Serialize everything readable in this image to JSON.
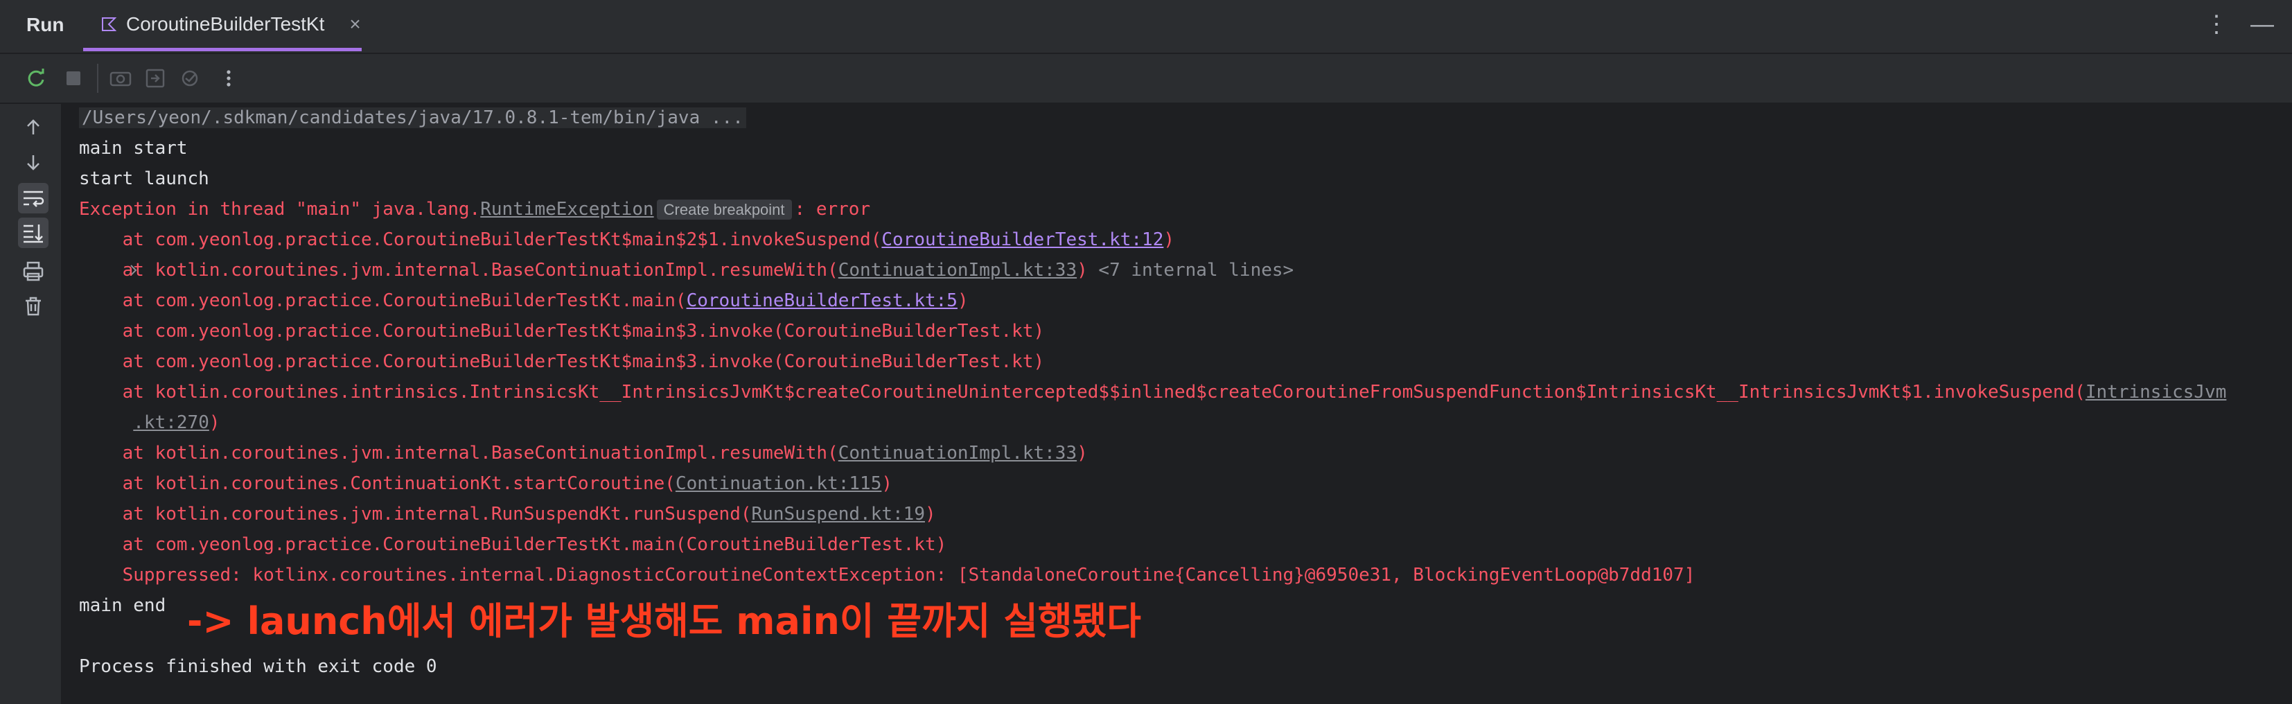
{
  "header": {
    "run_label": "Run",
    "active_tab": "CoroutineBuilderTestKt",
    "tab_close": "×",
    "more_icon": "⋮",
    "minimize_icon": "—"
  },
  "toolbar": {
    "icons": [
      "rerun-icon",
      "stop-icon",
      "camera-icon",
      "restore-layout-icon",
      "settings-icon",
      "more-icon"
    ]
  },
  "left_toolbar": {
    "icons": [
      "scroll-up-icon",
      "scroll-down-icon",
      "soft-wrap-icon",
      "scroll-to-end-icon",
      "print-icon",
      "clear-icon"
    ]
  },
  "console": {
    "command": "/Users/yeon/.sdkman/candidates/java/17.0.8.1-tem/bin/java ...",
    "main_start": "main start",
    "start_launch": "start launch",
    "exception_prefix": "Exception in thread \"main\" java.lang.",
    "exception_class": "RuntimeException",
    "create_breakpoint": "Create breakpoint",
    "exception_suffix": ": error",
    "stack": [
      {
        "pre": "    at com.yeonlog.practice.CoroutineBuilderTestKt$main$2$1.invokeSuspend(",
        "link": "CoroutineBuilderTest.kt:12",
        "post": ")"
      },
      {
        "pre": "    at kotlin.coroutines.jvm.internal.BaseContinuationImpl.resumeWith(",
        "link": "ContinuationImpl.kt:33",
        "post": ")",
        "extra": " <7 internal lines>"
      },
      {
        "pre": "    at com.yeonlog.practice.CoroutineBuilderTestKt.main(",
        "link": "CoroutineBuilderTest.kt:5",
        "post": ")"
      },
      {
        "pre": "    at com.yeonlog.practice.CoroutineBuilderTestKt$main$3.invoke(CoroutineBuilderTest.kt)"
      },
      {
        "pre": "    at com.yeonlog.practice.CoroutineBuilderTestKt$main$3.invoke(CoroutineBuilderTest.kt)"
      },
      {
        "pre": "    at kotlin.coroutines.intrinsics.IntrinsicsKt__IntrinsicsJvmKt$createCoroutineUnintercepted$$inlined$createCoroutineFromSuspendFunction$IntrinsicsKt__IntrinsicsJvmKt$1.invokeSuspend(",
        "link": "IntrinsicsJvm"
      },
      {
        "pre": "     ",
        "link": ".kt:270",
        "post": ")"
      },
      {
        "pre": "    at kotlin.coroutines.jvm.internal.BaseContinuationImpl.resumeWith(",
        "link": "ContinuationImpl.kt:33",
        "post": ")"
      },
      {
        "pre": "    at kotlin.coroutines.ContinuationKt.startCoroutine(",
        "link": "Continuation.kt:115",
        "post": ")"
      },
      {
        "pre": "    at kotlin.coroutines.jvm.internal.RunSuspendKt.runSuspend(",
        "link": "RunSuspend.kt:19",
        "post": ")"
      },
      {
        "pre": "    at com.yeonlog.practice.CoroutineBuilderTestKt.main(CoroutineBuilderTest.kt)"
      },
      {
        "pre": "    Suppressed: kotlinx.coroutines.internal.DiagnosticCoroutineContextException: [StandaloneCoroutine{Cancelling}@6950e31, BlockingEventLoop@b7dd107]"
      }
    ],
    "main_end": "main end",
    "annotation": "-> launch에서 에러가 발생해도 main이 끝까지 실행됐다",
    "process_finished": "Process finished with exit code 0"
  }
}
